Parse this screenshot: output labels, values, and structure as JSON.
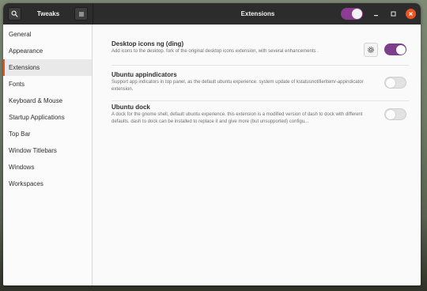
{
  "window": {
    "app_title": "Tweaks",
    "page_title": "Extensions",
    "extensions_master_enabled": true
  },
  "sidebar": {
    "selected": "Extensions",
    "items": [
      {
        "label": "General"
      },
      {
        "label": "Appearance"
      },
      {
        "label": "Extensions"
      },
      {
        "label": "Fonts"
      },
      {
        "label": "Keyboard & Mouse"
      },
      {
        "label": "Startup Applications"
      },
      {
        "label": "Top Bar"
      },
      {
        "label": "Window Titlebars"
      },
      {
        "label": "Windows"
      },
      {
        "label": "Workspaces"
      }
    ]
  },
  "extensions": [
    {
      "name": "Desktop icons ng (ding)",
      "description": "Add icons to the desktop. fork of the original desktop icons extension, with several enhancements .",
      "has_settings": true,
      "enabled": true
    },
    {
      "name": "Ubuntu appindicators",
      "description": "Support app indicators in top panel, as the default ubuntu experience. system update of kstatusnotifieritem/-appindicator extension.",
      "has_settings": false,
      "enabled": false
    },
    {
      "name": "Ubuntu dock",
      "description": "A dock for the gnome shell, default ubuntu experience. this extension is a modified version of dash to dock with different defaults. dash to dock can be installed to replace it and give more (but unsupported) configu...",
      "has_settings": false,
      "enabled": false
    }
  ],
  "colors": {
    "accent": "#7d3e8c",
    "selection_marker": "#e95420",
    "headerbar": "#2c2c2c"
  },
  "icons": {
    "search": "search-icon",
    "menu": "hamburger-menu-icon",
    "settings": "gear-icon",
    "minimize": "minimize-icon",
    "maximize": "maximize-icon",
    "close": "close-icon"
  }
}
